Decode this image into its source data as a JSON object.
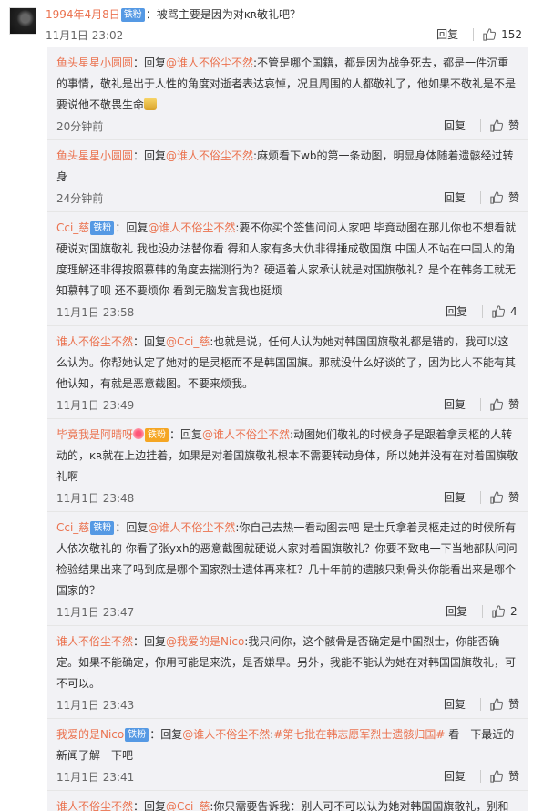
{
  "top": {
    "user": "1994年4月8日",
    "badge": "铁粉",
    "text": "：被骂主要是因为对ĸʀ敬礼吧？",
    "time": "11月1日 23:02",
    "reply": "回复",
    "likes": "152"
  },
  "replies": [
    {
      "user": "鱼头星星小圆圆",
      "badge": "",
      "pre": "：回复",
      "at": "@谁人不俗尘不然",
      "text": ":不管是哪个国籍，都是因为战争死去，都是一件沉重的事情，敬礼是出于人性的角度对逝者表达哀悼，况且周围的人都敬礼了，他如果不敬礼是不是要说他不敬畏生命",
      "emoji": true,
      "time": "20分钟前",
      "reply": "回复",
      "likes": "赞"
    },
    {
      "user": "鱼头星星小圆圆",
      "badge": "",
      "pre": "：回复",
      "at": "@谁人不俗尘不然",
      "text": ":麻烦看下wb的第一条动图，明显身体随着遗骸经过转身",
      "emoji": false,
      "time": "24分钟前",
      "reply": "回复",
      "likes": "赞"
    },
    {
      "user": "Cci_慈",
      "badge": "铁粉",
      "pre": "：回复",
      "at": "@谁人不俗尘不然",
      "text": ":要不你买个签售问问人家吧 毕竟动图在那儿你也不想看就硬说对国旗敬礼 我也没办法替你看 得和人家有多大仇非得捶成敬国旗 中国人不站在中国人的角度理解还非得按照慕韩的角度去揣测行为？硬逼着人家承认就是对国旗敬礼？是个在韩务工就无知慕韩了呗 还不要烦你 看到无脑发言我也挺烦",
      "emoji": false,
      "time": "11月1日 23:58",
      "reply": "回复",
      "likes": "4"
    },
    {
      "user": "谁人不俗尘不然",
      "badge": "",
      "pre": "：回复",
      "at": "@Cci_慈",
      "text": ":也就是说，任何人认为她对韩国国旗敬礼都是错的，我可以这么认为。你帮她认定了她对的是灵柩而不是韩国国旗。那就没什么好谈的了，因为比人不能有其他认知，有就是恶意截图。不要来烦我。",
      "emoji": false,
      "time": "11月1日 23:49",
      "reply": "回复",
      "likes": "赞"
    },
    {
      "user": "毕竟我是阿晴呀",
      "badge": "铁粉",
      "flower": true,
      "pre": "：回复",
      "at": "@谁人不俗尘不然",
      "text": ":动图她们敬礼的时候身子是跟着拿灵柩的人转动的，ĸʀ就在上边挂着，如果是对着国旗敬礼根本不需要转动身体，所以她并没有在对着国旗敬礼啊",
      "emoji": false,
      "time": "11月1日 23:48",
      "reply": "回复",
      "likes": "赞"
    },
    {
      "user": "Cci_慈",
      "badge": "铁粉",
      "pre": "：回复",
      "at": "@谁人不俗尘不然",
      "text": ":你自己去热一看动图去吧 是士兵拿着灵柩走过的时候所有人依次敬礼的 你看了张yxh的恶意截图就硬说人家对着国旗敬礼？你要不致电一下当地部队问问检验结果出来了吗到底是哪个国家烈士遗体再来杠？几十年前的遗骸只剩骨头你能看出来是哪个国家的？",
      "emoji": false,
      "time": "11月1日 23:47",
      "reply": "回复",
      "likes": "2"
    },
    {
      "user": "谁人不俗尘不然",
      "badge": "",
      "pre": "：回复",
      "at": "@我爱的是Nico",
      "text": ":我只问你，这个骸骨是否确定是中国烈士，你能否确定。如果不能确定，你用可能是来洗，是否嫌早。另外，我能不能认为她在对韩国国旗敬礼，可不可以。",
      "emoji": false,
      "time": "11月1日 23:43",
      "reply": "回复",
      "likes": "赞"
    },
    {
      "user": "我爱的是Nico",
      "badge": "铁粉",
      "pre": "：回复",
      "at": "@谁人不俗尘不然",
      "text": ":",
      "topic": "#第七批在韩志愿军烈士遗骸归国#",
      "text2": " 看一下最近的新闻了解一下吧",
      "emoji": false,
      "time": "11月1日 23:41",
      "reply": "回复",
      "likes": "赞"
    },
    {
      "user": "谁人不俗尘不然",
      "badge": "",
      "pre": "：回复",
      "at": "@Cci_慈",
      "text": ":你只需要告诉我：别人可不可以认为她对韩国国旗敬礼，别和我扯其他有的没的。",
      "emoji": false,
      "time": "",
      "reply": "",
      "likes": ""
    }
  ]
}
